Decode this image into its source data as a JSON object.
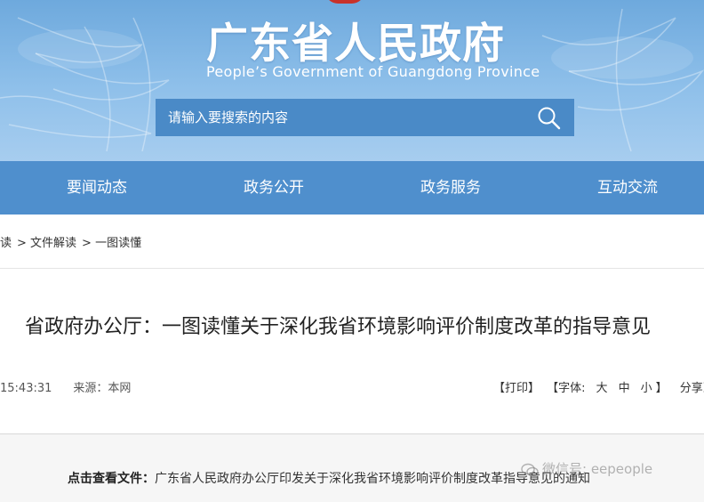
{
  "header": {
    "title": "广东省人民政府",
    "subtitle": "People’s Government of Guangdong Province"
  },
  "search": {
    "placeholder": "请输入要搜索的内容"
  },
  "nav": {
    "items": [
      {
        "label": "要闻动态"
      },
      {
        "label": "政务公开"
      },
      {
        "label": "政务服务"
      },
      {
        "label": "互动交流"
      }
    ]
  },
  "breadcrumb": {
    "items": [
      "读",
      "> 文件解读",
      "> 一图读懂"
    ]
  },
  "article": {
    "title": "省政府办公厅：一图读懂关于深化我省环境影响评价制度改革的指导意见",
    "time": "15:43:31",
    "source": "来源：本网",
    "print": "【打印】",
    "font_label": "【字体:",
    "font_large": "大",
    "font_medium": "中",
    "font_small": "小",
    "font_close": "】",
    "share": "分享到"
  },
  "content": {
    "label": "点击查看文件：",
    "link": "广东省人民政府办公厅印发关于深化我省环境影响评价制度改革指导意见的通知"
  },
  "watermark": {
    "text": "微信号: eepeople"
  },
  "colors": {
    "nav": "#4f8fcd",
    "search": "#4a8ac7",
    "emblem": "#c8322a"
  }
}
